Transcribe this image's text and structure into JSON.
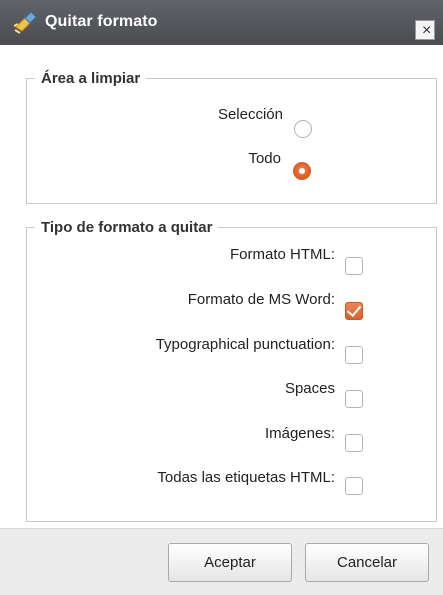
{
  "dialog": {
    "title": "Quitar formato",
    "title_icon": "eraser-brush-icon",
    "close_label": "×"
  },
  "area": {
    "legend": "Área a limpiar",
    "options": [
      {
        "label": "Selección",
        "selected": false
      },
      {
        "label": "Todo",
        "selected": true
      }
    ]
  },
  "tipo": {
    "legend": "Tipo de formato a quitar",
    "options": [
      {
        "label": "Formato HTML:",
        "checked": false
      },
      {
        "label": "Formato de MS Word:",
        "checked": true
      },
      {
        "label": "Typographical punctuation:",
        "checked": false
      },
      {
        "label": "Spaces",
        "checked": false
      },
      {
        "label": "Imágenes:",
        "checked": false
      },
      {
        "label": "Todas las etiquetas HTML:",
        "checked": false
      }
    ]
  },
  "buttons": {
    "ok": "Aceptar",
    "cancel": "Cancelar"
  },
  "colors": {
    "accent": "#e2622b",
    "titlebar": "#55575b"
  }
}
